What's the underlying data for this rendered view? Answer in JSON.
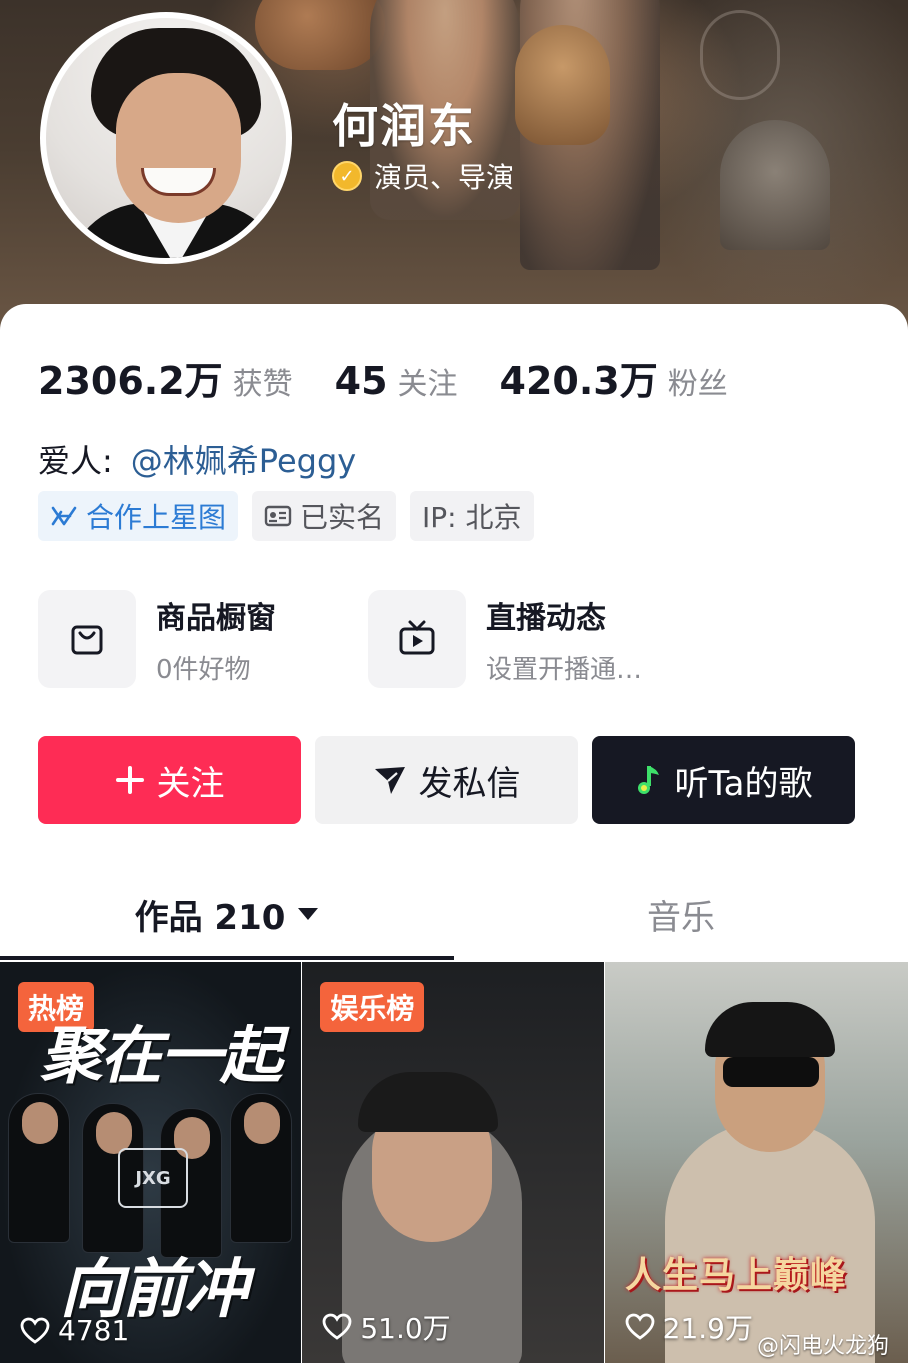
{
  "profile": {
    "name": "何润东",
    "verification": "演员、导演"
  },
  "stats": [
    {
      "value": "2306.2万",
      "label": "获赞"
    },
    {
      "value": "45",
      "label": "关注"
    },
    {
      "value": "420.3万",
      "label": "粉丝"
    }
  ],
  "spouse": {
    "label": "爱人:",
    "name": "@林姵希Peggy"
  },
  "tags": [
    {
      "label": "合作上星图",
      "icon": "star-map-icon"
    },
    {
      "label": "已实名",
      "icon": "id-card-icon"
    },
    {
      "label": "IP: 北京"
    }
  ],
  "features": [
    {
      "title": "商品橱窗",
      "subtitle": "0件好物",
      "icon": "shopping-bag-icon"
    },
    {
      "title": "直播动态",
      "subtitle": "设置开播通…",
      "icon": "tv-icon"
    }
  ],
  "actions": {
    "follow": "关注",
    "message": "发私信",
    "music": "听Ta的歌"
  },
  "tabs": {
    "works": "作品 210",
    "music": "音乐"
  },
  "videos": [
    {
      "badge": "热榜",
      "likes": "4781",
      "overlay_top": "聚在一起",
      "overlay_bottom": "向前冲",
      "logo": "JXG"
    },
    {
      "badge": "娱乐榜",
      "likes": "51.0万"
    },
    {
      "likes": "21.9万",
      "overlay": "人生马上巅峰"
    }
  ],
  "watermark": "@闪电火龙狗",
  "colors": {
    "follow_button": "#fe2c55",
    "link": "#2c5e94",
    "verify": "#f2b82c",
    "badge": "#f4643c",
    "dark_button": "#161823"
  }
}
